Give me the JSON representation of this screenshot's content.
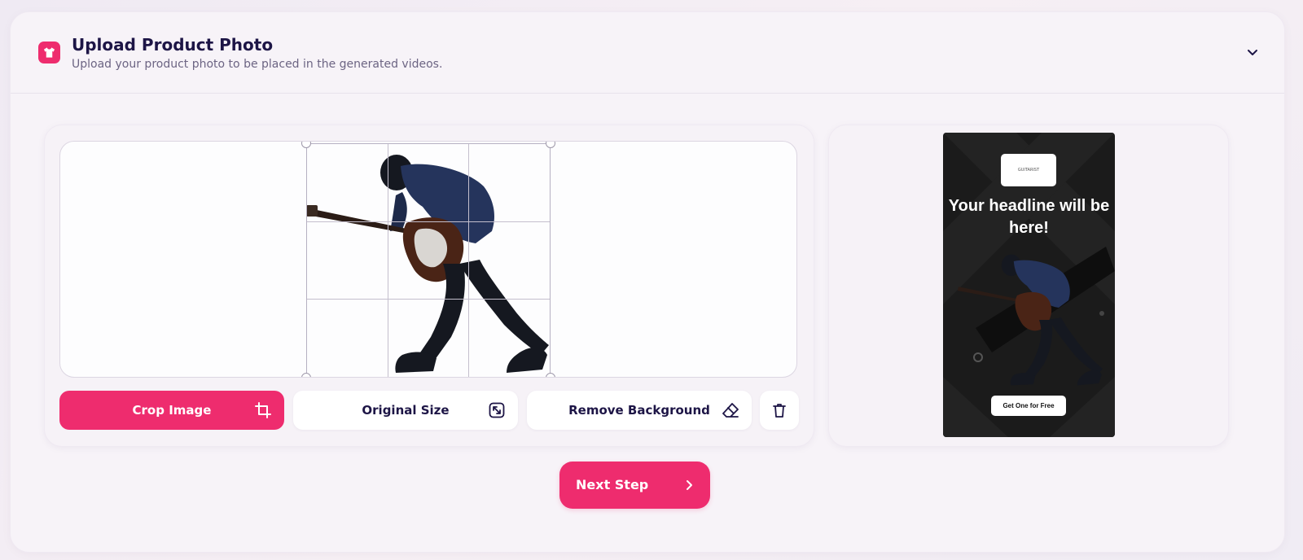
{
  "header": {
    "title": "Upload Product Photo",
    "subtitle": "Upload your product photo to be placed in the generated videos.",
    "icon": "tshirt-icon",
    "collapse_icon": "chevron-down-icon"
  },
  "editor": {
    "image_subject": "guitarist-silhouette",
    "buttons": {
      "crop": "Crop Image",
      "original": "Original Size",
      "remove_bg": "Remove Background"
    },
    "icons": {
      "crop": "crop-icon",
      "original": "resize-icon",
      "remove_bg": "eraser-icon",
      "delete": "trash-icon"
    }
  },
  "preview": {
    "logo_text": "GUITARIST",
    "headline": "Your headline will be here!",
    "cta": "Get One for Free"
  },
  "next_step": {
    "label": "Next Step",
    "icon": "chevron-right-icon"
  },
  "colors": {
    "accent": "#ee2c6e",
    "text_dark": "#1d1546",
    "text_muted": "#6c6483",
    "preview_bg": "#1b1b1b"
  }
}
